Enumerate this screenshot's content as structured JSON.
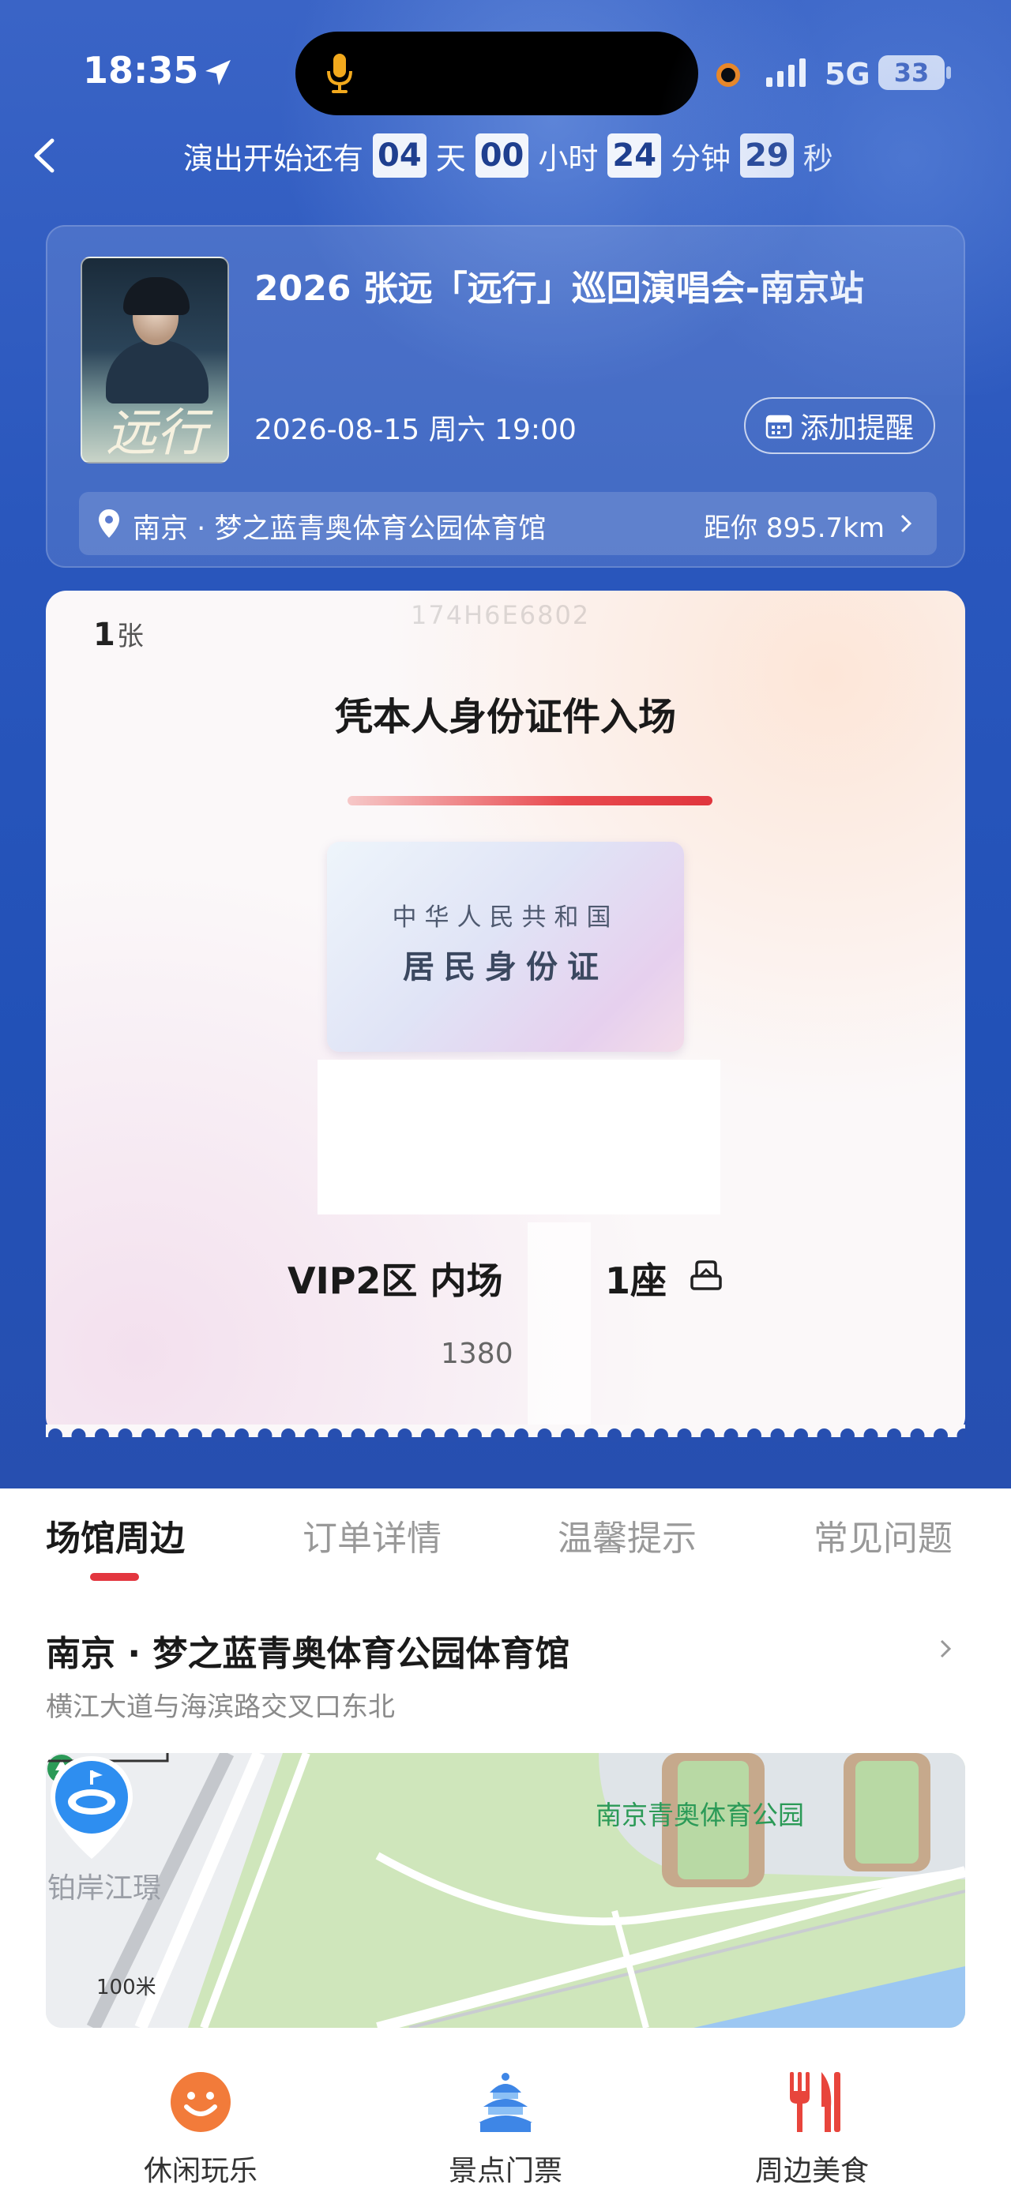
{
  "status_bar": {
    "time": "18:35",
    "network": "5G",
    "battery": "33"
  },
  "countdown": {
    "prefix": "演出开始还有",
    "days": "04",
    "days_unit": "天",
    "hours": "00",
    "hours_unit": "小时",
    "minutes": "24",
    "minutes_unit": "分钟",
    "seconds": "29",
    "seconds_unit": "秒"
  },
  "event": {
    "poster_text": "远行",
    "title": "2026 张远「远行」巡回演唱会-南京站",
    "datetime": "2026-08-15 周六 19:00",
    "remind_label": "添加提醒",
    "venue": "南京 · 梦之蓝青奥体育公园体育馆",
    "distance": "距你 895.7km"
  },
  "ticket": {
    "count": "1",
    "count_unit": "张",
    "faded_code": "174H6E6802",
    "entry_title": "凭本人身份证件入场",
    "id_country": "中华人民共和国",
    "id_type": "居民身份证",
    "zone": "VIP2区 内场",
    "seat": "1座",
    "price": "1380"
  },
  "tabs": [
    {
      "label": "场馆周边",
      "active": true
    },
    {
      "label": "订单详情",
      "active": false
    },
    {
      "label": "温馨提示",
      "active": false
    },
    {
      "label": "常见问题",
      "active": false
    }
  ],
  "nearby": {
    "venue_name": "南京 · 梦之蓝青奥体育公园体育馆",
    "address": "横江大道与海滨路交叉口东北"
  },
  "map": {
    "park_label": "南京青奥体育公园",
    "west_label": "铂岸江璟",
    "scale": "100米"
  },
  "bottom_nav": [
    {
      "label": "休闲玩乐",
      "icon": "smile-icon"
    },
    {
      "label": "景点门票",
      "icon": "temple-icon"
    },
    {
      "label": "周边美食",
      "icon": "fork-knife-icon"
    }
  ],
  "colors": {
    "accent_red": "#e3363f",
    "hero_blue": "#2a57bd",
    "park_green": "#2b9a57"
  }
}
